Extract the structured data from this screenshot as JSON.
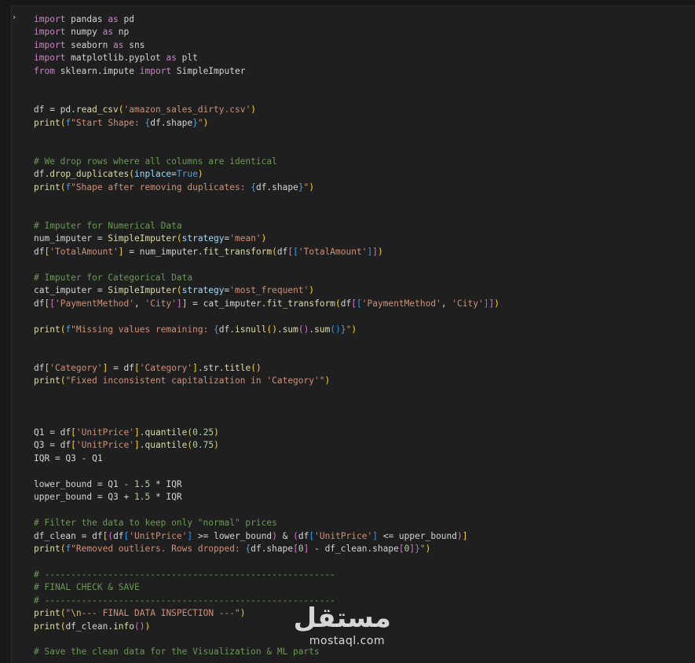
{
  "gutter": {
    "run_indicator": "›"
  },
  "code": [
    [
      [
        "kw",
        "import"
      ],
      [
        "tx",
        " pandas "
      ],
      [
        "kw",
        "as"
      ],
      [
        "tx",
        " pd"
      ]
    ],
    [
      [
        "kw",
        "import"
      ],
      [
        "tx",
        " numpy "
      ],
      [
        "kw",
        "as"
      ],
      [
        "tx",
        " np"
      ]
    ],
    [
      [
        "kw",
        "import"
      ],
      [
        "tx",
        " seaborn "
      ],
      [
        "kw",
        "as"
      ],
      [
        "tx",
        " sns"
      ]
    ],
    [
      [
        "kw",
        "import"
      ],
      [
        "tx",
        " matplotlib.pyplot "
      ],
      [
        "kw",
        "as"
      ],
      [
        "tx",
        " plt"
      ]
    ],
    [
      [
        "kw",
        "from"
      ],
      [
        "tx",
        " sklearn.impute "
      ],
      [
        "kw",
        "import"
      ],
      [
        "tx",
        " SimpleImputer"
      ]
    ],
    [],
    [],
    [
      [
        "tx",
        "df = pd."
      ],
      [
        "fn",
        "read_csv"
      ],
      [
        "br1",
        "("
      ],
      [
        "st",
        "'amazon_sales_dirty.csv'"
      ],
      [
        "br1",
        ")"
      ]
    ],
    [
      [
        "fn",
        "print"
      ],
      [
        "br1",
        "("
      ],
      [
        "bl",
        "f"
      ],
      [
        "st",
        "\"Start Shape: "
      ],
      [
        "bl",
        "{"
      ],
      [
        "tx",
        "df.shape"
      ],
      [
        "bl",
        "}"
      ],
      [
        "st",
        "\""
      ],
      [
        "br1",
        ")"
      ]
    ],
    [],
    [],
    [
      [
        "cm",
        "# We drop rows where all columns are identical"
      ]
    ],
    [
      [
        "tx",
        "df."
      ],
      [
        "fn",
        "drop_duplicates"
      ],
      [
        "br1",
        "("
      ],
      [
        "pm",
        "inplace"
      ],
      [
        "tx",
        "="
      ],
      [
        "bl",
        "True"
      ],
      [
        "br1",
        ")"
      ]
    ],
    [
      [
        "fn",
        "print"
      ],
      [
        "br1",
        "("
      ],
      [
        "bl",
        "f"
      ],
      [
        "st",
        "\"Shape after removing duplicates: "
      ],
      [
        "bl",
        "{"
      ],
      [
        "tx",
        "df.shape"
      ],
      [
        "bl",
        "}"
      ],
      [
        "st",
        "\""
      ],
      [
        "br1",
        ")"
      ]
    ],
    [],
    [],
    [
      [
        "cm",
        "# Imputer for Numerical Data"
      ]
    ],
    [
      [
        "tx",
        "num_imputer = "
      ],
      [
        "fn",
        "SimpleImputer"
      ],
      [
        "br1",
        "("
      ],
      [
        "pm",
        "strategy"
      ],
      [
        "tx",
        "="
      ],
      [
        "st",
        "'mean'"
      ],
      [
        "br1",
        ")"
      ]
    ],
    [
      [
        "tx",
        "df"
      ],
      [
        "br1",
        "["
      ],
      [
        "st",
        "'TotalAmount'"
      ],
      [
        "br1",
        "]"
      ],
      [
        "tx",
        " = num_imputer."
      ],
      [
        "fn",
        "fit_transform"
      ],
      [
        "br1",
        "("
      ],
      [
        "tx",
        "df"
      ],
      [
        "br2",
        "["
      ],
      [
        "br3",
        "["
      ],
      [
        "st",
        "'TotalAmount'"
      ],
      [
        "br3",
        "]"
      ],
      [
        "br2",
        "]"
      ],
      [
        "br1",
        ")"
      ]
    ],
    [],
    [
      [
        "cm",
        "# Imputer for Categorical Data"
      ]
    ],
    [
      [
        "tx",
        "cat_imputer = "
      ],
      [
        "fn",
        "SimpleImputer"
      ],
      [
        "br1",
        "("
      ],
      [
        "pm",
        "strategy"
      ],
      [
        "tx",
        "="
      ],
      [
        "st",
        "'most_frequent'"
      ],
      [
        "br1",
        ")"
      ]
    ],
    [
      [
        "tx",
        "df"
      ],
      [
        "br1",
        "["
      ],
      [
        "br2",
        "["
      ],
      [
        "st",
        "'PaymentMethod'"
      ],
      [
        "tx",
        ", "
      ],
      [
        "st",
        "'City'"
      ],
      [
        "br2",
        "]"
      ],
      [
        "br1",
        "]"
      ],
      [
        "tx",
        " = cat_imputer."
      ],
      [
        "fn",
        "fit_transform"
      ],
      [
        "br1",
        "("
      ],
      [
        "tx",
        "df"
      ],
      [
        "br2",
        "["
      ],
      [
        "br3",
        "["
      ],
      [
        "st",
        "'PaymentMethod'"
      ],
      [
        "tx",
        ", "
      ],
      [
        "st",
        "'City'"
      ],
      [
        "br3",
        "]"
      ],
      [
        "br2",
        "]"
      ],
      [
        "br1",
        ")"
      ]
    ],
    [],
    [
      [
        "fn",
        "print"
      ],
      [
        "br1",
        "("
      ],
      [
        "bl",
        "f"
      ],
      [
        "st",
        "\"Missing values remaining: "
      ],
      [
        "bl",
        "{"
      ],
      [
        "tx",
        "df."
      ],
      [
        "fn",
        "isnull"
      ],
      [
        "br1",
        "("
      ],
      [
        "br1",
        ")"
      ],
      [
        "tx",
        "."
      ],
      [
        "fn",
        "sum"
      ],
      [
        "br2",
        "("
      ],
      [
        "br2",
        ")"
      ],
      [
        "tx",
        "."
      ],
      [
        "fn",
        "sum"
      ],
      [
        "br3",
        "("
      ],
      [
        "br3",
        ")"
      ],
      [
        "bl",
        "}"
      ],
      [
        "st",
        "\""
      ],
      [
        "br1",
        ")"
      ]
    ],
    [],
    [],
    [
      [
        "tx",
        "df"
      ],
      [
        "br1",
        "["
      ],
      [
        "st",
        "'Category'"
      ],
      [
        "br1",
        "]"
      ],
      [
        "tx",
        " = df"
      ],
      [
        "br1",
        "["
      ],
      [
        "st",
        "'Category'"
      ],
      [
        "br1",
        "]"
      ],
      [
        "tx",
        ".str."
      ],
      [
        "fn",
        "title"
      ],
      [
        "br1",
        "("
      ],
      [
        "br1",
        ")"
      ]
    ],
    [
      [
        "fn",
        "print"
      ],
      [
        "br1",
        "("
      ],
      [
        "st",
        "\"Fixed inconsistent capitalization in 'Category'\""
      ],
      [
        "br1",
        ")"
      ]
    ],
    [],
    [],
    [],
    [
      [
        "tx",
        "Q1 = df"
      ],
      [
        "br1",
        "["
      ],
      [
        "st",
        "'UnitPrice'"
      ],
      [
        "br1",
        "]"
      ],
      [
        "tx",
        "."
      ],
      [
        "fn",
        "quantile"
      ],
      [
        "br1",
        "("
      ],
      [
        "nm",
        "0.25"
      ],
      [
        "br1",
        ")"
      ]
    ],
    [
      [
        "tx",
        "Q3 = df"
      ],
      [
        "br1",
        "["
      ],
      [
        "st",
        "'UnitPrice'"
      ],
      [
        "br1",
        "]"
      ],
      [
        "tx",
        "."
      ],
      [
        "fn",
        "quantile"
      ],
      [
        "br1",
        "("
      ],
      [
        "nm",
        "0.75"
      ],
      [
        "br1",
        ")"
      ]
    ],
    [
      [
        "tx",
        "IQR = Q3 - Q1"
      ]
    ],
    [],
    [
      [
        "tx",
        "lower_bound = Q1 - "
      ],
      [
        "nm",
        "1.5"
      ],
      [
        "tx",
        " * IQR"
      ]
    ],
    [
      [
        "tx",
        "upper_bound = Q3 + "
      ],
      [
        "nm",
        "1.5"
      ],
      [
        "tx",
        " * IQR"
      ]
    ],
    [],
    [
      [
        "cm",
        "# Filter the data to keep only \"normal\" prices"
      ]
    ],
    [
      [
        "tx",
        "df_clean = df"
      ],
      [
        "br1",
        "["
      ],
      [
        "br2",
        "("
      ],
      [
        "tx",
        "df"
      ],
      [
        "br3",
        "["
      ],
      [
        "st",
        "'UnitPrice'"
      ],
      [
        "br3",
        "]"
      ],
      [
        "tx",
        " >= lower_bound"
      ],
      [
        "br2",
        ")"
      ],
      [
        "tx",
        " & "
      ],
      [
        "br2",
        "("
      ],
      [
        "tx",
        "df"
      ],
      [
        "br3",
        "["
      ],
      [
        "st",
        "'UnitPrice'"
      ],
      [
        "br3",
        "]"
      ],
      [
        "tx",
        " <= upper_bound"
      ],
      [
        "br2",
        ")"
      ],
      [
        "br1",
        "]"
      ]
    ],
    [
      [
        "fn",
        "print"
      ],
      [
        "br1",
        "("
      ],
      [
        "bl",
        "f"
      ],
      [
        "st",
        "\"Removed outliers. Rows dropped: "
      ],
      [
        "bl",
        "{"
      ],
      [
        "tx",
        "df.shape"
      ],
      [
        "br2",
        "["
      ],
      [
        "nm",
        "0"
      ],
      [
        "br2",
        "]"
      ],
      [
        "tx",
        " - df_clean.shape"
      ],
      [
        "br2",
        "["
      ],
      [
        "nm",
        "0"
      ],
      [
        "br2",
        "]"
      ],
      [
        "bl",
        "}"
      ],
      [
        "st",
        "\""
      ],
      [
        "br1",
        ")"
      ]
    ],
    [],
    [
      [
        "cm",
        "# -------------------------------------------------------"
      ]
    ],
    [
      [
        "cm",
        "# FINAL CHECK & SAVE"
      ]
    ],
    [
      [
        "cm",
        "# -------------------------------------------------------"
      ]
    ],
    [
      [
        "fn",
        "print"
      ],
      [
        "br1",
        "("
      ],
      [
        "st",
        "\""
      ],
      [
        "es",
        "\\n"
      ],
      [
        "st",
        "--- FINAL DATA INSPECTION ---\""
      ],
      [
        "br1",
        ")"
      ]
    ],
    [
      [
        "fn",
        "print"
      ],
      [
        "br1",
        "("
      ],
      [
        "tx",
        "df_clean."
      ],
      [
        "fn",
        "info"
      ],
      [
        "br2",
        "("
      ],
      [
        "br2",
        ")"
      ],
      [
        "br1",
        ")"
      ]
    ],
    [],
    [
      [
        "cm",
        "# Save the clean data for the Visualization & ML parts"
      ]
    ]
  ],
  "watermark": {
    "arabic": "مستقل",
    "latin": "mostaql.com"
  }
}
